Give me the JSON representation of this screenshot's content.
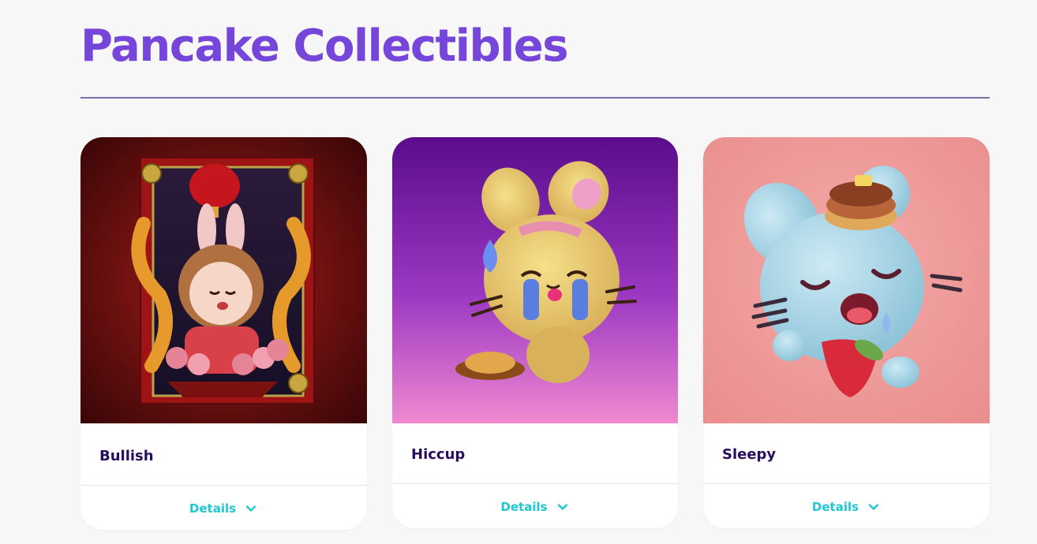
{
  "header": {
    "title": "Pancake Collectibles"
  },
  "collectibles": [
    {
      "name": "Bullish",
      "details_label": "Details"
    },
    {
      "name": "Hiccup",
      "details_label": "Details"
    },
    {
      "name": "Sleepy",
      "details_label": "Details"
    }
  ],
  "colors": {
    "title": "#7645d9",
    "card_name": "#280d5f",
    "details": "#1fc7d4",
    "divider": "#7a6eaa"
  },
  "icons": {
    "details_expand": "chevron-down-icon"
  }
}
